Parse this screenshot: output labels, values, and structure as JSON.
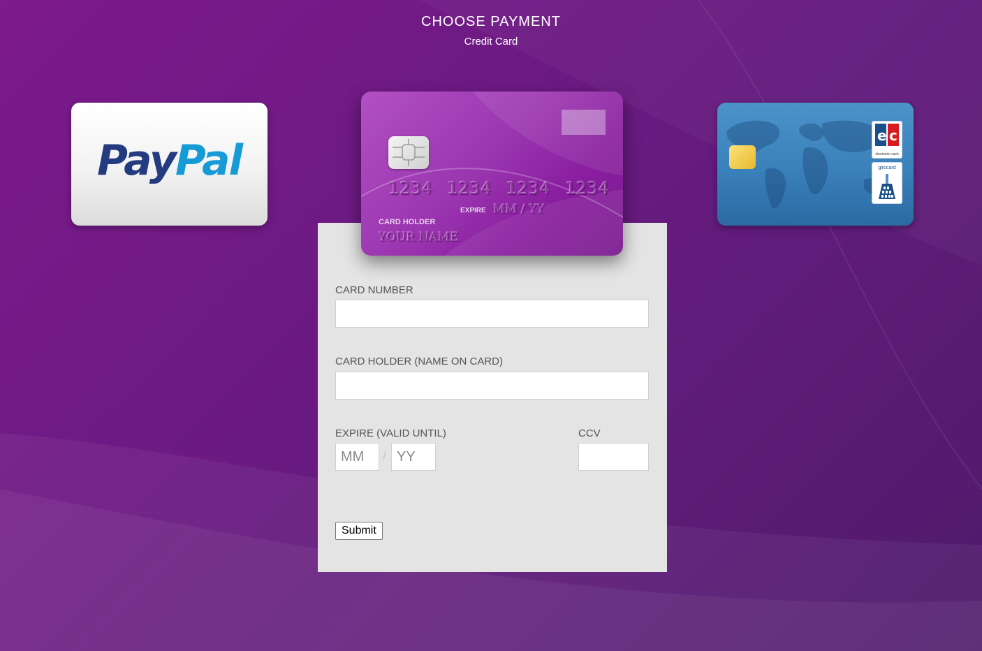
{
  "header": {
    "title": "CHOOSE PAYMENT",
    "subtitle": "Credit Card"
  },
  "payment_options": {
    "paypal": {
      "logo_pay": "Pay",
      "logo_pal": "Pal"
    },
    "credit_card": {
      "number": "1234 1234 1234 1234",
      "expire_label": "EXPIRE",
      "expire_value": "MM / YY",
      "holder_label": "CARD HOLDER",
      "holder_value": "YOUR NAME"
    },
    "ec_card": {
      "badge_text": "electronic cash",
      "giro_text": "girocard"
    }
  },
  "form": {
    "card_number_label": "CARD NUMBER",
    "card_number_value": "",
    "holder_label": "CARD HOLDER (NAME ON CARD)",
    "holder_value": "",
    "expire_label": "EXPIRE (VALID UNTIL)",
    "month_placeholder": "MM",
    "separator": "/",
    "year_placeholder": "YY",
    "ccv_label": "CCV",
    "ccv_value": "",
    "submit_label": "Submit"
  },
  "colors": {
    "background": "#6e1a84",
    "form_panel": "#e4e4e4",
    "paypal_dark": "#253b80",
    "paypal_light": "#179bd7",
    "ec_blue": "#3a80ba"
  }
}
